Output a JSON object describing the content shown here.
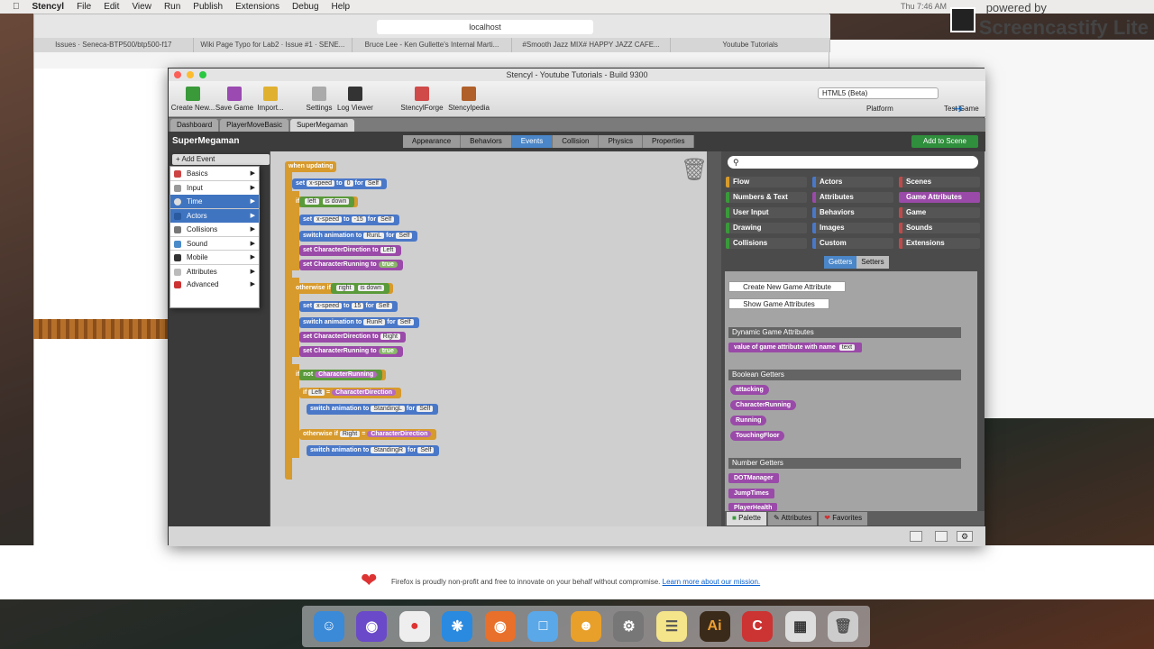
{
  "menubar": {
    "app": "Stencyl",
    "items": [
      "File",
      "Edit",
      "View",
      "Run",
      "Publish",
      "Extensions",
      "Debug",
      "Help"
    ],
    "time": "Thu 7:46 AM"
  },
  "watermark": {
    "pre": "powered by",
    "name": "Screencastify Lite"
  },
  "browser": {
    "url": "localhost",
    "tabs": [
      "Issues · Seneca-BTP500/btp500-f17",
      "Wiki Page Typo for Lab2 · Issue #1 · SENE...",
      "Bruce Lee - Ken Gullette's Internal Marti...",
      "#Smooth Jazz MIX# HAPPY JAZZ CAFE...",
      "Youtube Tutorials"
    ],
    "firefox_msg": "Firefox is proudly non-profit and free to innovate on your behalf without compromise.",
    "firefox_link": "Learn more about our mission."
  },
  "stencyl": {
    "title": "Stencyl - Youtube Tutorials - Build 9300",
    "toolbar": [
      "Create New...",
      "Save Game",
      "Import...",
      "Settings",
      "Log Viewer",
      "StencylForge",
      "Stencylpedia"
    ],
    "platform": "HTML5 (Beta)",
    "platform_label": "Platform",
    "test_label": "Test Game",
    "tabs": [
      "Dashboard",
      "PlayerMoveBasic",
      "SuperMegaman"
    ],
    "name": "SuperMegaman",
    "segments": [
      "Appearance",
      "Behaviors",
      "Events",
      "Collision",
      "Physics",
      "Properties"
    ],
    "add_scene": "Add to Scene",
    "add_event": "+ Add Event",
    "menu": [
      "Basics",
      "Input",
      "Time",
      "Actors",
      "Collisions",
      "Sound",
      "Mobile",
      "Attributes",
      "Advanced"
    ],
    "palette": {
      "categories": [
        "Flow",
        "Actors",
        "Scenes",
        "Numbers & Text",
        "Attributes",
        "Game Attributes",
        "User Input",
        "Behaviors",
        "Game",
        "Drawing",
        "Images",
        "Sounds",
        "Collisions",
        "Custom",
        "Extensions"
      ],
      "getters": "Getters",
      "setters": "Setters",
      "create_btn": "Create New Game Attribute",
      "show_btn": "Show Game Attributes",
      "dyn_head": "Dynamic Game Attributes",
      "dyn_block": "value of game attribute with name",
      "dyn_text": "text",
      "bool_head": "Boolean Getters",
      "bools": [
        "attacking",
        "CharacterRunning",
        "Running",
        "TouchingFloor"
      ],
      "num_head": "Number Getters",
      "nums": [
        "DOTManager",
        "JumpTimes",
        "PlayerHealth"
      ],
      "footer": [
        "Palette",
        "Attributes",
        "Favorites"
      ]
    },
    "blocks": {
      "when": "when updating",
      "set": "set",
      "xspeed": "x-speed",
      "to": "to",
      "zero": "0",
      "for": "for",
      "self": "Self",
      "if": "if",
      "left": "left",
      "isdown": "is down",
      "right": "right",
      "neg15": "-15",
      "pos15": "15",
      "switch": "switch animation to",
      "runl": "RunL",
      "runr": "RunR",
      "setdir": "set CharacterDirection to",
      "dirleft": "Left",
      "dirright": "Right",
      "setrun": "set CharacterRunning to",
      "true": "true",
      "otherwise": "otherwise if",
      "not": "not",
      "charrun": "CharacterRunning",
      "leftv": "Left",
      "eq": "=",
      "chardir": "CharacterDirection",
      "rightv": "Right",
      "standl": "StandingL",
      "standr": "StandingR"
    }
  },
  "colors": {
    "accent": "#4a86c8",
    "events_orange": "#d79a2c",
    "actor_blue": "#4a78c8",
    "attr_purple": "#9a4aa8",
    "green": "#2f8f3c"
  }
}
